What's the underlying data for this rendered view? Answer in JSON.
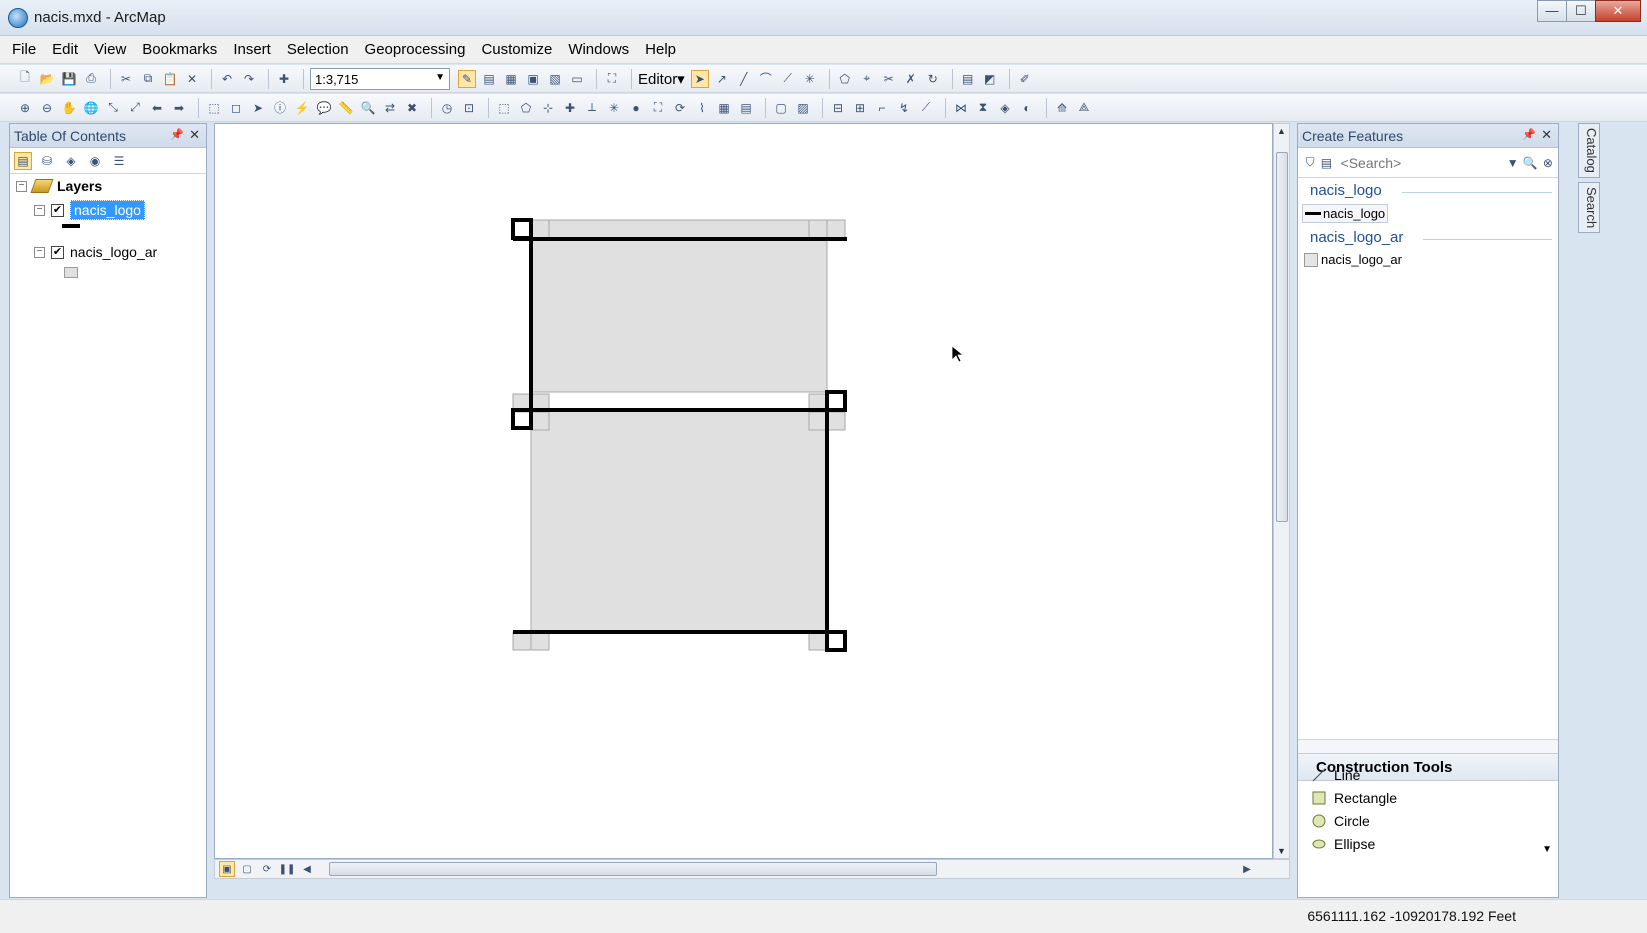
{
  "window": {
    "title": "nacis.mxd - ArcMap",
    "controls": [
      "—",
      "☐",
      "✕"
    ]
  },
  "menu": [
    "File",
    "Edit",
    "View",
    "Bookmarks",
    "Insert",
    "Selection",
    "Geoprocessing",
    "Customize",
    "Windows",
    "Help"
  ],
  "toolbar": {
    "scale": "1:3,715",
    "editor_label": "Editor▾"
  },
  "toc": {
    "title": "Table Of Contents",
    "root_label": "Layers",
    "layers": [
      {
        "name": "nacis_logo",
        "checked": true,
        "selected": true,
        "symbol": "line"
      },
      {
        "name": "nacis_logo_ar",
        "checked": true,
        "selected": false,
        "symbol": "polygon"
      }
    ]
  },
  "create_features": {
    "title": "Create Features",
    "search_placeholder": "<Search>",
    "groups": [
      {
        "name": "nacis_logo",
        "template": "nacis_logo",
        "type": "line"
      },
      {
        "name": "nacis_logo_ar",
        "template": "nacis_logo_ar",
        "type": "polygon"
      }
    ],
    "construction_tools_title": "Construction Tools",
    "tools": [
      "Line",
      "Rectangle",
      "Circle",
      "Ellipse"
    ]
  },
  "dock_tabs": [
    "Catalog",
    "Search"
  ],
  "status": {
    "coordinates": "6561111.162  -10920178.192 Feet"
  },
  "colors": {
    "selection": "#3399ff",
    "feature_fill": "#e0e0e0",
    "line": "#000000",
    "group_header": "#1f4f9a"
  }
}
